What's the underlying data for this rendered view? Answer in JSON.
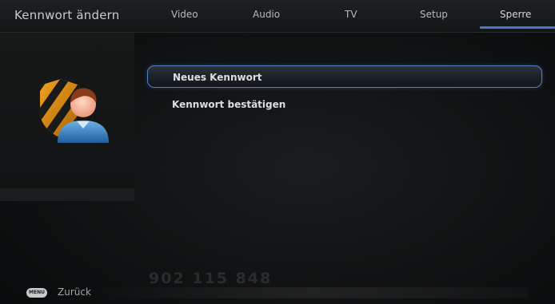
{
  "header": {
    "title": "Kennwort ändern",
    "tabs": [
      {
        "label": "Video"
      },
      {
        "label": "Audio"
      },
      {
        "label": "TV"
      },
      {
        "label": "Setup"
      },
      {
        "label": "Sperre",
        "active": true
      }
    ]
  },
  "sidebar": {
    "icon": "parental-lock-user-icon"
  },
  "menu": {
    "items": [
      {
        "label": "Neues Kennwort",
        "selected": true
      },
      {
        "label": "Kennwort bestätigen",
        "selected": false
      }
    ]
  },
  "footer": {
    "key_label": "MENU",
    "back_label": "Zurück"
  },
  "background_text": {
    "number": "902 115 848"
  },
  "colors": {
    "accent": "#4c78c8",
    "background": "#0b0c0d",
    "text": "#dcdedf"
  }
}
